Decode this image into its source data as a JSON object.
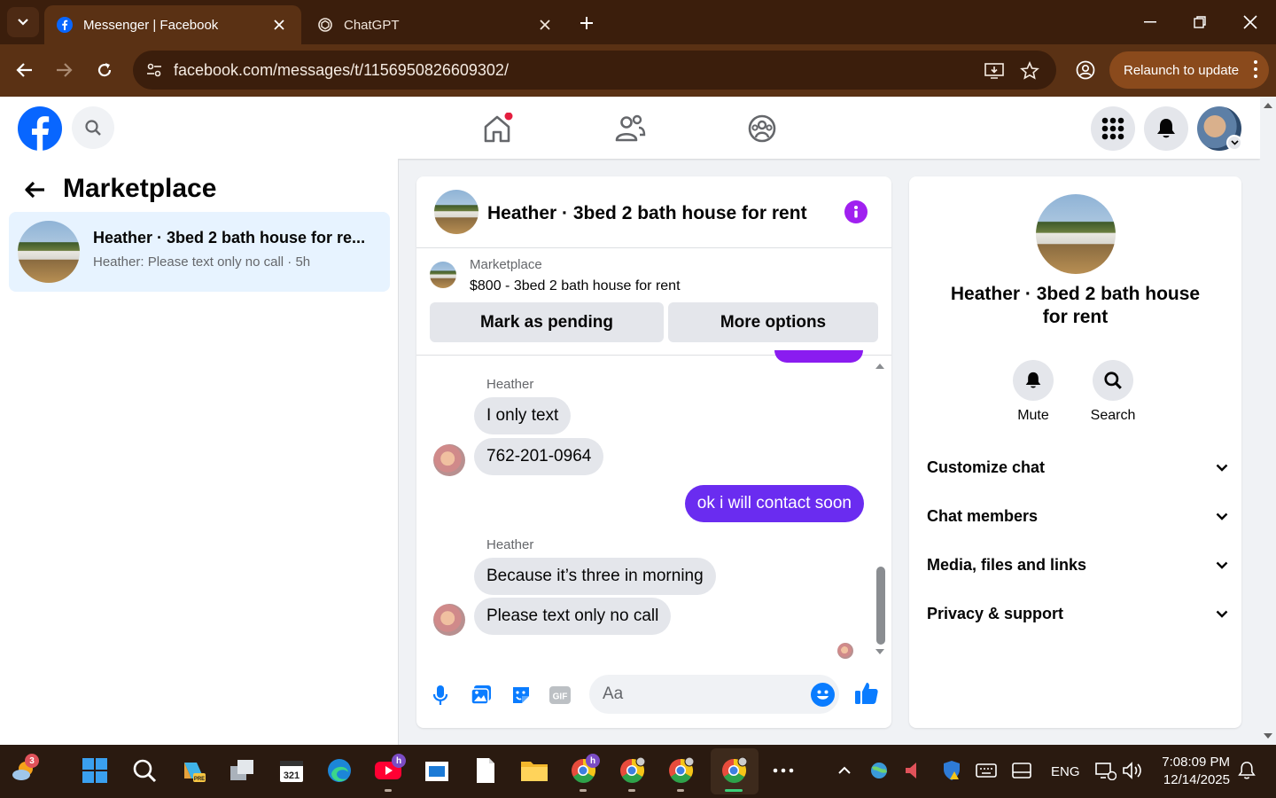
{
  "browser": {
    "tabs": [
      {
        "title": "Messenger | Facebook",
        "icon": "facebook-icon",
        "active": true
      },
      {
        "title": "ChatGPT",
        "icon": "chatgpt-icon",
        "active": false
      }
    ],
    "url": "facebook.com/messages/t/1156950826609302/",
    "relaunch_label": "Relaunch to update"
  },
  "fb_nav": {
    "home_notification": true,
    "colors": {
      "brand": "#0866ff",
      "notification": "#e41e3f"
    }
  },
  "left_panel": {
    "title": "Marketplace",
    "conversations": [
      {
        "name": "Heather · 3bed 2 bath house for re...",
        "preview": "Heather: Please text only no call · 5h"
      }
    ]
  },
  "chat": {
    "title": "Heather · 3bed 2 bath house for rent",
    "marketplace": {
      "label": "Marketplace",
      "listing": "$800 - 3bed 2 bath house for rent",
      "mark_pending": "Mark as pending",
      "more_options": "More options"
    },
    "messages": [
      {
        "sender": "Heather",
        "text": "I only text",
        "direction": "in"
      },
      {
        "text": "762-201-0964",
        "direction": "in"
      },
      {
        "text": "ok i will contact soon",
        "direction": "out"
      },
      {
        "sender": "Heather",
        "text": "Because it’s three in morning",
        "direction": "in"
      },
      {
        "text": "Please text only no call",
        "direction": "in"
      }
    ],
    "composer_placeholder": "Aa",
    "colors": {
      "outgoing": "#6a2cf0",
      "accent": "#a020f0"
    }
  },
  "details": {
    "name": "Heather · 3bed 2 bath house for rent",
    "actions": [
      {
        "label": "Mute",
        "icon": "bell-icon"
      },
      {
        "label": "Search",
        "icon": "search-icon"
      }
    ],
    "sections": [
      "Customize chat",
      "Chat members",
      "Media, files and links",
      "Privacy & support"
    ]
  },
  "taskbar": {
    "weather_badge": "3",
    "profile_badge": "h",
    "language": "ENG",
    "time": "7:08:09 PM",
    "date": "12/14/2025"
  }
}
